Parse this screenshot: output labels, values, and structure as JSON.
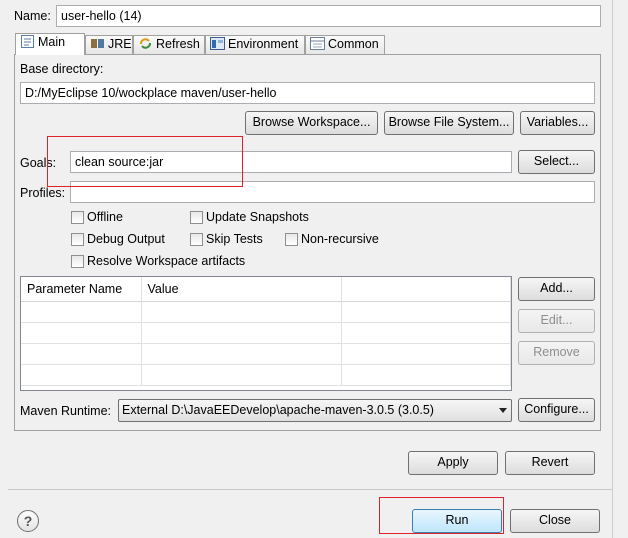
{
  "name": {
    "label": "Name:",
    "value": "user-hello (14)"
  },
  "tabs": [
    {
      "label": "Main",
      "icon": "main-tab-icon"
    },
    {
      "label": "JRE",
      "icon": "jre-icon"
    },
    {
      "label": "Refresh",
      "icon": "refresh-icon"
    },
    {
      "label": "Environment",
      "icon": "environment-icon"
    },
    {
      "label": "Common",
      "icon": "common-icon"
    }
  ],
  "main": {
    "base_directory_label": "Base directory:",
    "base_directory_value": "D:/MyEclipse 10/wockplace maven/user-hello",
    "browse_workspace": "Browse Workspace...",
    "browse_file_system": "Browse File System...",
    "variables": "Variables...",
    "goals_label": "Goals:",
    "goals_value": "clean source:jar",
    "select": "Select...",
    "profiles_label": "Profiles:",
    "profiles_value": "",
    "checkboxes": {
      "offline": "Offline",
      "update_snapshots": "Update Snapshots",
      "debug_output": "Debug Output",
      "skip_tests": "Skip Tests",
      "non_recursive": "Non-recursive",
      "resolve_workspace": "Resolve Workspace artifacts"
    },
    "params_table": {
      "columns": [
        "Parameter Name",
        "Value"
      ],
      "rows": []
    },
    "add": "Add...",
    "edit": "Edit...",
    "remove": "Remove",
    "maven_runtime_label": "Maven Runtime:",
    "maven_runtime_value": "External D:\\JavaEEDevelop\\apache-maven-3.0.5 (3.0.5)",
    "configure": "Configure...",
    "apply": "Apply",
    "revert": "Revert"
  },
  "footer": {
    "help_glyph": "?",
    "run": "Run",
    "close": "Close"
  },
  "colors": {
    "highlight": "#e0202a",
    "accent": "#3c7fb1"
  }
}
